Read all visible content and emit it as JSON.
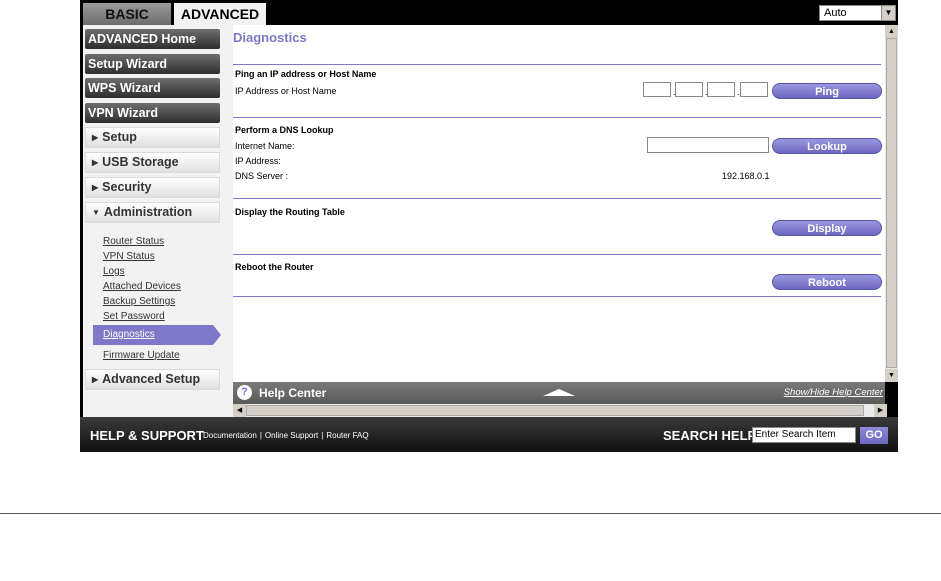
{
  "tabs": {
    "basic": "BASIC",
    "advanced": "ADVANCED"
  },
  "language": {
    "selected": "Auto"
  },
  "sidebar": {
    "buttons": [
      "ADVANCED Home",
      "Setup Wizard",
      "WPS Wizard",
      "VPN Wizard"
    ],
    "sections": [
      "Setup",
      "USB Storage",
      "Security",
      "Administration"
    ],
    "admin_links": [
      "Router Status",
      "VPN Status",
      "Logs",
      "Attached Devices",
      "Backup Settings",
      "Set Password"
    ],
    "active_link": "Diagnostics",
    "firmware_link": "Firmware Update",
    "advanced_setup": "Advanced Setup"
  },
  "content": {
    "title": "Diagnostics",
    "ping": {
      "heading": "Ping an IP address or Host Name",
      "label": "IP Address or Host Name",
      "button": "Ping",
      "dots": [
        ".",
        ".",
        "."
      ]
    },
    "dns": {
      "heading": "Perform a DNS Lookup",
      "internet_name": "Internet Name:",
      "ip_address": "IP Address:",
      "dns_server_label": "DNS Server :",
      "dns_server_value": "192.168.0.1",
      "button": "Lookup"
    },
    "routing": {
      "heading": "Display the Routing Table",
      "button": "Display"
    },
    "reboot": {
      "heading": "Reboot the Router",
      "button": "Reboot"
    }
  },
  "helpbar": {
    "title": "Help Center",
    "toggle": "Show/Hide Help Center"
  },
  "footer": {
    "help_support": "HELP & SUPPORT",
    "links": [
      "Documentation",
      "Online Support",
      "Router FAQ"
    ],
    "search_help": "SEARCH HELP",
    "search_placeholder": "Enter Search Item",
    "go": "GO"
  },
  "colors": {
    "accent": "#7d78c8",
    "bar": "#000000"
  }
}
